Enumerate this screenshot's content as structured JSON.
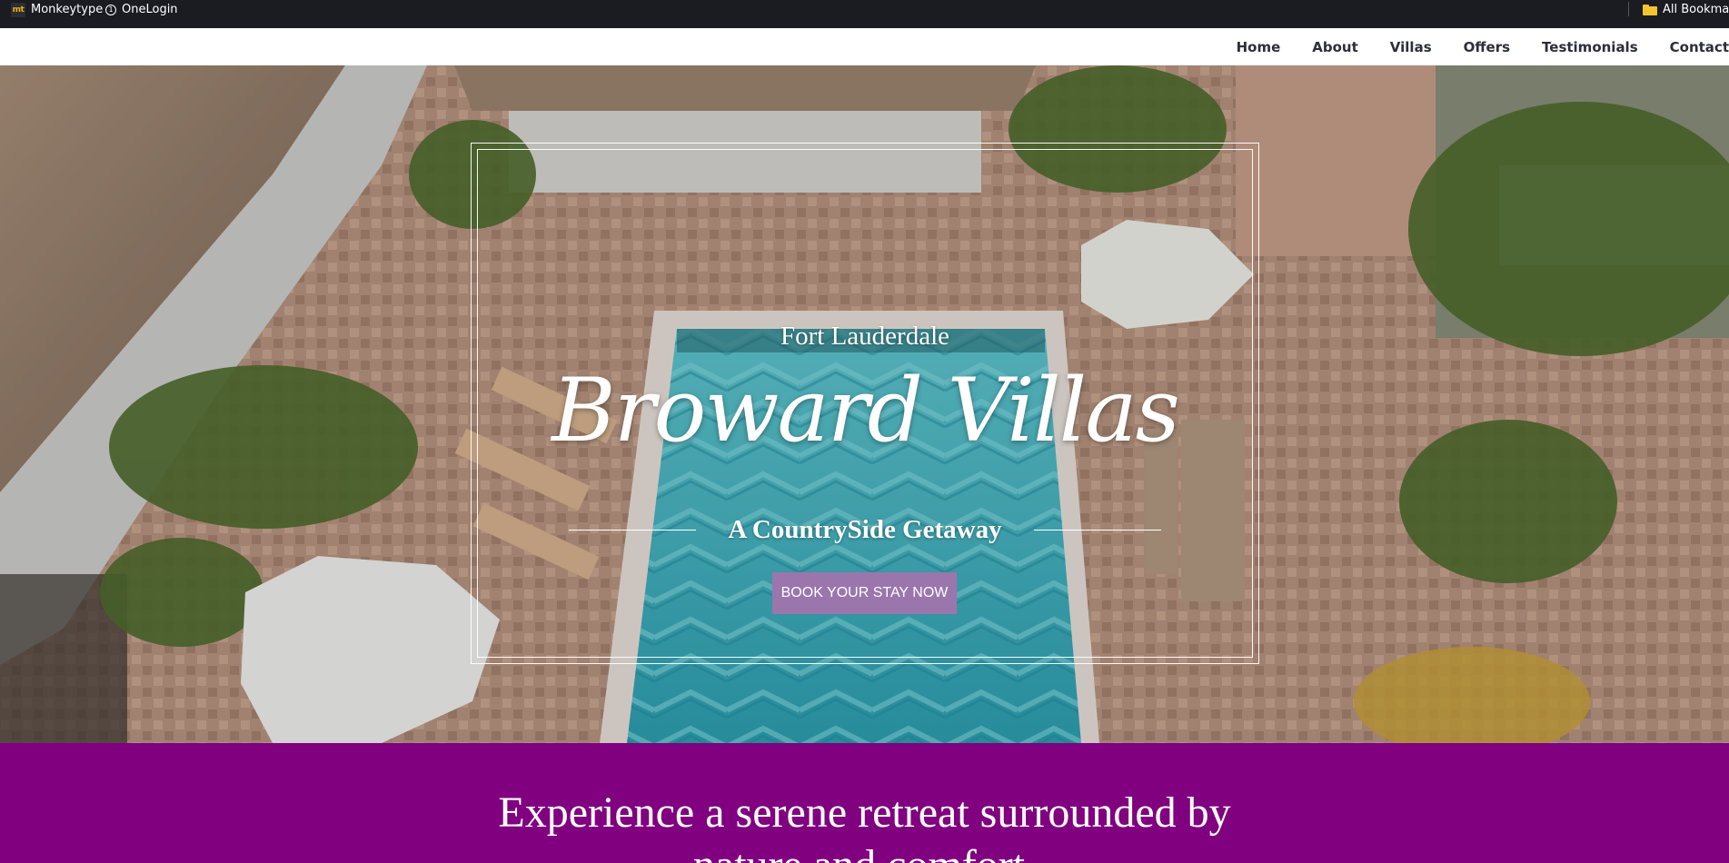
{
  "bookmarks": {
    "items": [
      {
        "label": "Monkeytype",
        "icon": "monkeytype-icon",
        "icon_text": "mt"
      },
      {
        "label": "OneLogin",
        "icon": "onelogin-icon",
        "icon_text": "1"
      }
    ],
    "all_bookmarks": {
      "label": "All Bookmarks",
      "icon": "folder-icon"
    }
  },
  "nav": {
    "links": [
      "Home",
      "About",
      "Villas",
      "Offers",
      "Testimonials",
      "Contact"
    ]
  },
  "hero": {
    "location": "Fort Lauderdale",
    "title": "Broward Villas",
    "tagline": "A CountrySide Getaway",
    "cta_label": "BOOK YOUR STAY NOW"
  },
  "intro": {
    "text": "Experience a serene retreat surrounded by nature and comfort."
  },
  "colors": {
    "bookmarks_bg": "#1b1b22",
    "nav_text": "#2b2f3a",
    "cta_bg": "#9b76ad",
    "intro_bg": "#800080"
  }
}
